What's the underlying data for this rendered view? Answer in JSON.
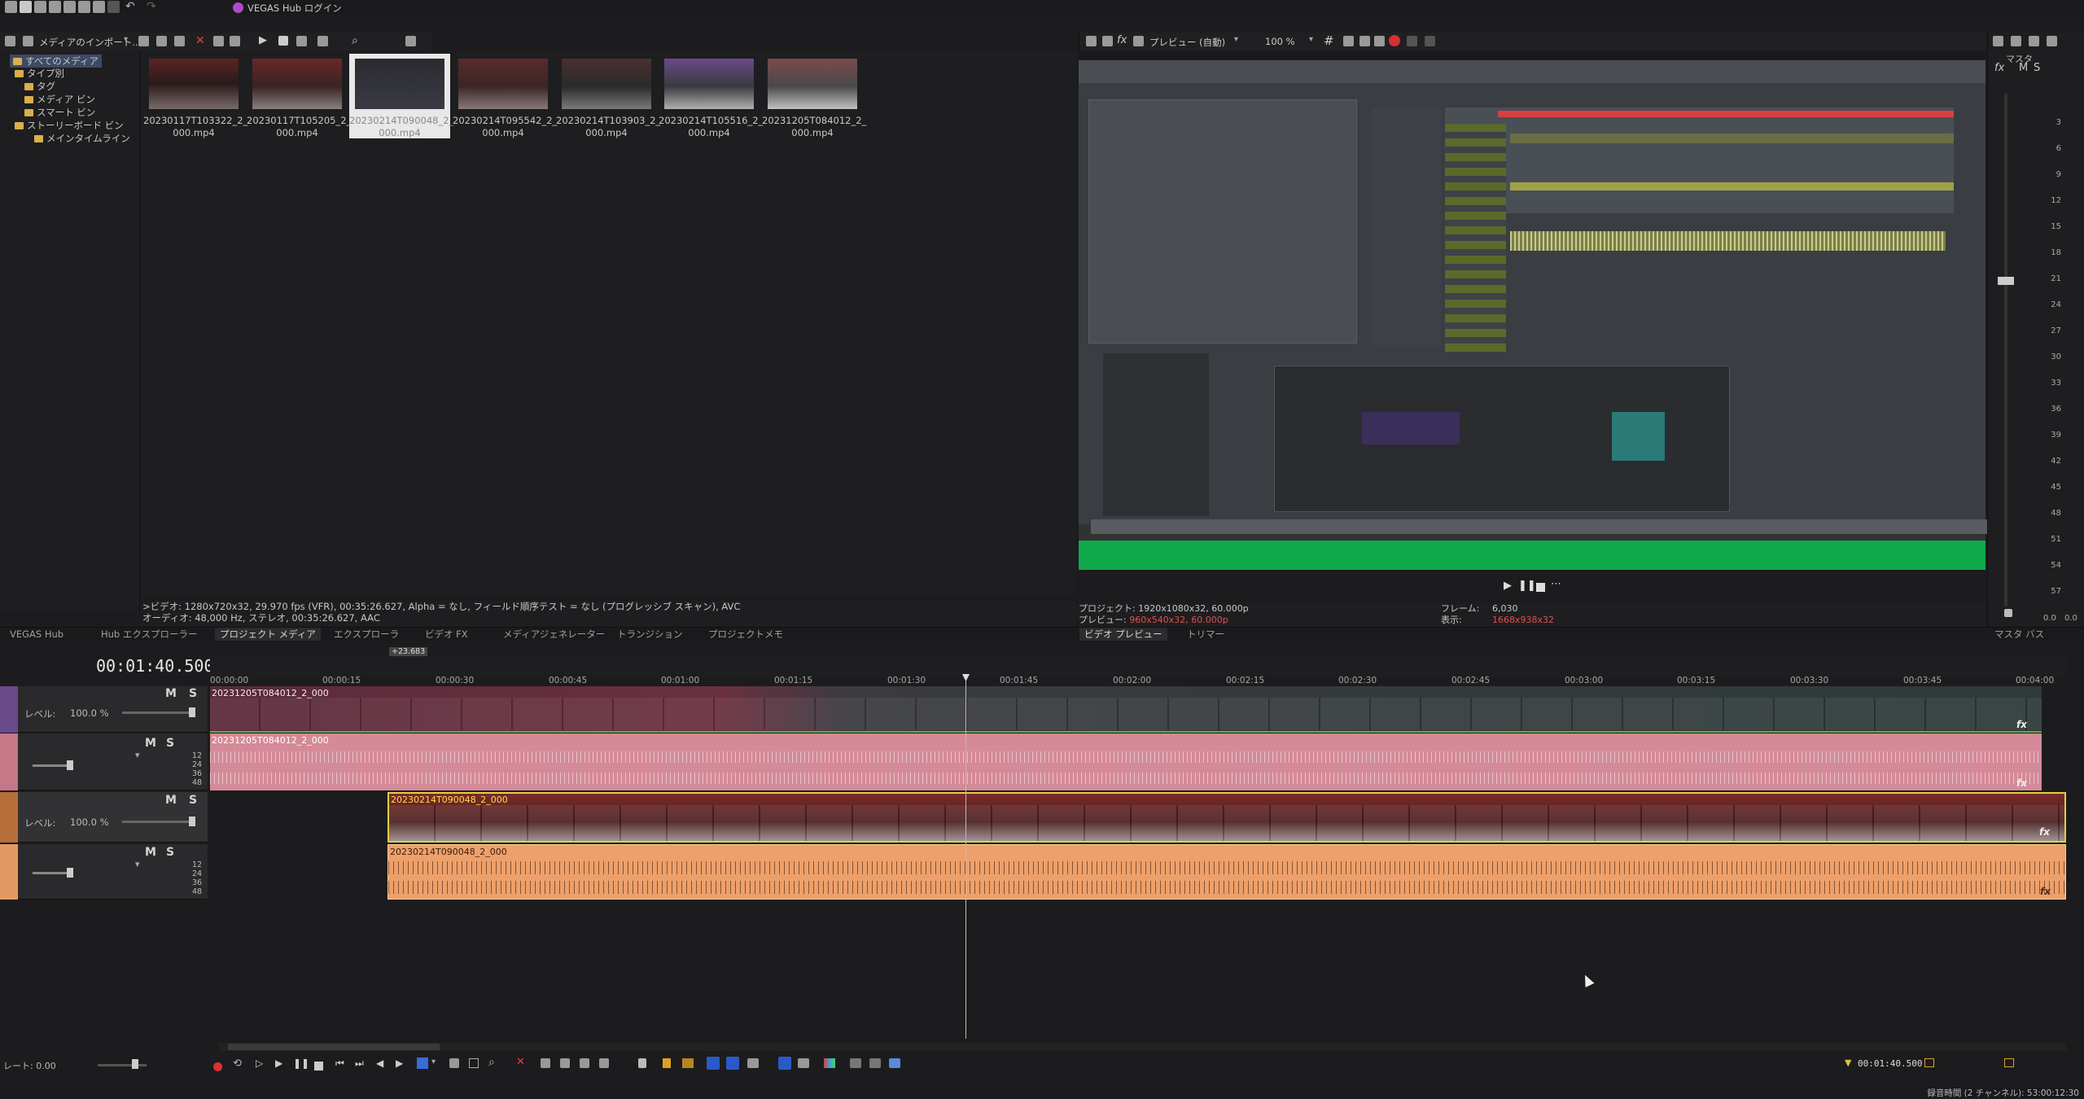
{
  "titlebar": {
    "app_title": "VEGAS Hub ログイン"
  },
  "explorer": {
    "import_label": "メディアのインポート...",
    "tree": [
      "すべてのメディア",
      "タイプ別",
      "タグ",
      "メディア ビン",
      "スマート ビン",
      "ストーリーボード ビン",
      "メインタイムライン"
    ],
    "media": [
      {
        "name": "20230117T103322_2_000.mp4",
        "line1": "20230117T103322_2_",
        "line2": "000.mp4"
      },
      {
        "name": "20230117T105205_2_000.mp4",
        "line1": "20230117T105205_2_",
        "line2": "000.mp4"
      },
      {
        "name": "20230214T090048_2_000.mp4",
        "line1": "20230214T090048_2_",
        "line2": "000.mp4"
      },
      {
        "name": "20230214T095542_2_000.mp4",
        "line1": "20230214T095542_2_",
        "line2": "000.mp4"
      },
      {
        "name": "20230214T103903_2_000.mp4",
        "line1": "20230214T103903_2_",
        "line2": "000.mp4"
      },
      {
        "name": "20230214T105516_2_000.mp4",
        "line1": "20230214T105516_2_",
        "line2": "000.mp4"
      },
      {
        "name": "20231205T084012_2_000.mp4",
        "line1": "20231205T084012_2_",
        "line2": "000.mp4"
      }
    ],
    "video_info": ">ビデオ: 1280x720x32, 29.970 fps (VFR), 00:35:26.627, Alpha = なし, フィールド順序テスト = なし (プログレッシブ スキャン), AVC",
    "audio_info": "オーディオ: 48,000 Hz, ステレオ, 00:35:26.627, AAC"
  },
  "dock_tabs": {
    "left_brand": "VEGAS Hub",
    "items": [
      "Hub エクスプローラー",
      "プロジェクト メディア",
      "エクスプローラ",
      "ビデオ FX",
      "メディアジェネレーター",
      "トランジション",
      "プロジェクトメモ"
    ],
    "preview_tabs": [
      "ビデオ プレビュー",
      "トリマー"
    ],
    "master_tab": "マスタ バス"
  },
  "preview": {
    "mode": "プレビュー (自動)",
    "zoom": "100 %",
    "project_label": "プロジェクト:",
    "project_value": "1920x1080x32, 60.000p",
    "preview_label": "プレビュー:",
    "preview_value": "960x540x32, 60.000p",
    "frame_label": "フレーム:",
    "frame_value": "6,030",
    "display_label": "表示:",
    "display_value": "1668x938x32",
    "accent_red": "#e03a3a",
    "green_bar": "#0fa84a"
  },
  "master": {
    "label": "マスタ",
    "fx_label": "fx",
    "m_label": "M",
    "s_label": "S",
    "scale": [
      "3",
      "6",
      "9",
      "12",
      "15",
      "18",
      "21",
      "24",
      "27",
      "30",
      "33",
      "36",
      "39",
      "42",
      "45",
      "48",
      "51",
      "54",
      "57"
    ],
    "val_left": "0.0",
    "val_right": "0.0"
  },
  "timeline": {
    "timecode": "00:01:40.500",
    "marker_badge": "+23.683",
    "ruler": [
      "00:00:00",
      "00:00:15",
      "00:00:30",
      "00:00:45",
      "00:01:00",
      "00:01:15",
      "00:01:30",
      "00:01:45",
      "00:02:00",
      "00:02:15",
      "00:02:30",
      "00:02:45",
      "00:03:00",
      "00:03:15",
      "00:03:30",
      "00:03:45",
      "00:04:00"
    ],
    "tracks": [
      {
        "type": "video",
        "level_label": "レベル:",
        "level": "100.0 %",
        "m": "M",
        "s": "S",
        "clip": "20231205T084012_2_000",
        "color": "#7a4a8e"
      },
      {
        "type": "audio",
        "m": "M",
        "s": "S",
        "scale": [
          "12",
          "24",
          "36",
          "48"
        ],
        "clip": "20231205T084012_2_000",
        "color": "#d48a98"
      },
      {
        "type": "video",
        "level_label": "レベル:",
        "level": "100.0 %",
        "m": "M",
        "s": "S",
        "clip": "20230214T090048_2_000",
        "color": "#c27a3a"
      },
      {
        "type": "audio",
        "m": "M",
        "s": "S",
        "scale": [
          "12",
          "24",
          "36",
          "48"
        ],
        "clip": "20230214T090048_2_000",
        "color": "#eda06a"
      }
    ],
    "rate_label": "レート: 0.00",
    "cursor_time": "00:01:40.500",
    "status": "録音時間 (2 チャンネル): 53:00:12:30"
  }
}
